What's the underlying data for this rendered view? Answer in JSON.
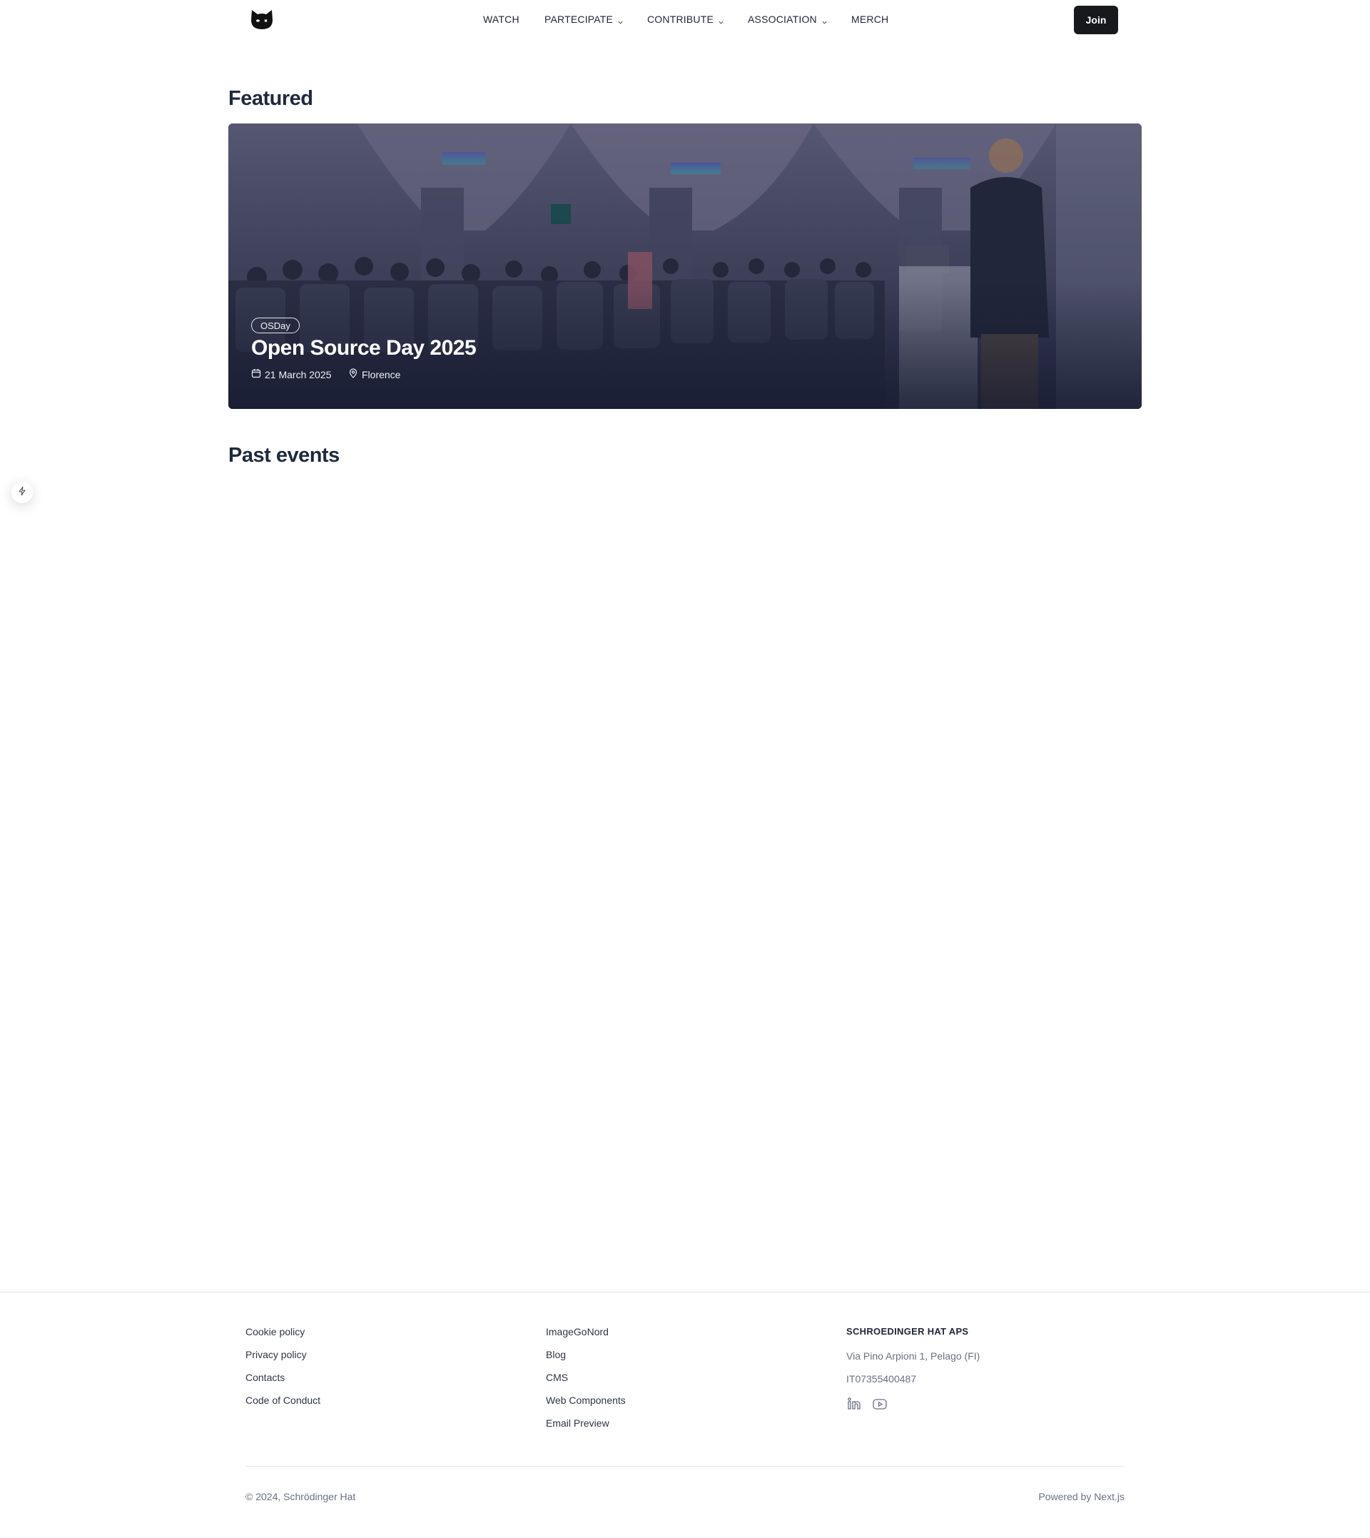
{
  "header": {
    "nav": [
      {
        "label": "WATCH",
        "has_dropdown": false
      },
      {
        "label": "PARTECIPATE",
        "has_dropdown": true
      },
      {
        "label": "CONTRIBUTE",
        "has_dropdown": true
      },
      {
        "label": "ASSOCIATION",
        "has_dropdown": true
      },
      {
        "label": "MERCH",
        "has_dropdown": false
      }
    ],
    "join_label": "Join"
  },
  "featured": {
    "heading": "Featured",
    "card": {
      "badge": "OSDay",
      "title": "Open Source Day 2025",
      "date": "21 March 2025",
      "location": "Florence"
    }
  },
  "past_events": {
    "heading": "Past events"
  },
  "footer": {
    "col1": [
      "Cookie policy",
      "Privacy policy",
      "Contacts",
      "Code of Conduct"
    ],
    "col2": [
      "ImageGoNord",
      "Blog",
      "CMS",
      "Web Components",
      "Email Preview"
    ],
    "company": {
      "name": "SCHROEDINGER HAT APS",
      "address": "Via Pino Arpioni 1, Pelago (FI)",
      "vat": "IT07355400487"
    },
    "copyright": "© 2024, Schrödinger Hat",
    "powered_by": "Powered by Next.js"
  },
  "icons": [
    "cat-logo-icon",
    "chevron-down-icon",
    "calendar-icon",
    "location-pin-icon",
    "lightning-icon",
    "linkedin-icon",
    "youtube-icon"
  ],
  "colors": {
    "heading": "#1e2a3d",
    "button_bg": "#18191d",
    "footer_text": "#6b7183"
  }
}
